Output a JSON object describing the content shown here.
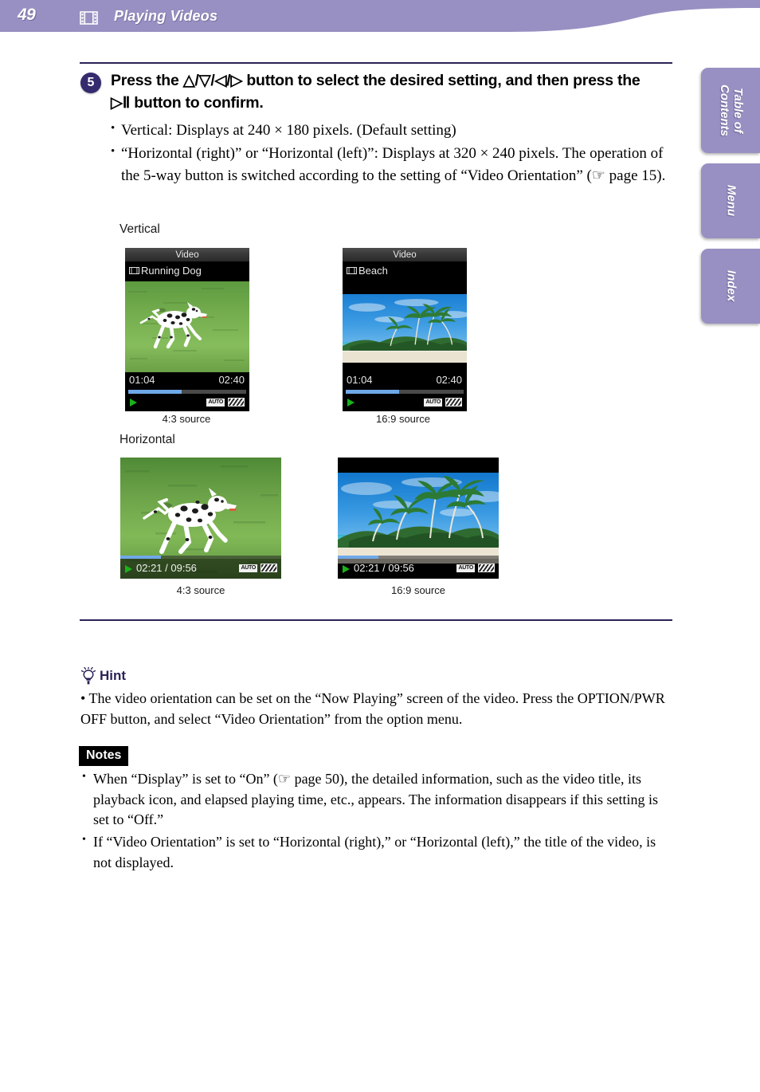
{
  "header": {
    "page_number": "49",
    "title": "Playing Videos",
    "film_icon": "film-strip-icon",
    "bg_color": "#9890c2"
  },
  "side_tabs": [
    {
      "label": "Table of\nContents",
      "name": "table-of-contents"
    },
    {
      "label": "Menu",
      "name": "menu"
    },
    {
      "label": "Index",
      "name": "index"
    }
  ],
  "step": {
    "number": "5",
    "heading": "Press the △/▽/◁/▷ button to select the desired setting, and then press the ▷Ⅱ button to confirm.",
    "bullets": [
      "Vertical: Displays at 240 × 180 pixels. (Default setting)",
      "“Horizontal (right)” or “Horizontal (left)”: Displays at 320 × 240 pixels. The operation of the 5-way button is switched according to the setting of “Video Orientation” (☞ page 15)."
    ]
  },
  "figures": {
    "label_vertical": "Vertical",
    "label_horizontal": "Horizontal",
    "captions": {
      "v43": "4:3 source",
      "v169": "16:9 source",
      "h43": "4:3 source",
      "h169": "16:9 source"
    },
    "vertical_43": {
      "screen_title": "Video",
      "video_title": "Running Dog",
      "time_current": "01:04",
      "time_total": "02:40",
      "progress_percent": 45,
      "badge_auto": "AUTO",
      "play_icon": "play-triangle-icon",
      "battery_icon": "battery-icon"
    },
    "vertical_169": {
      "screen_title": "Video",
      "video_title": "Beach",
      "time_current": "01:04",
      "time_total": "02:40",
      "progress_percent": 45,
      "badge_auto": "AUTO",
      "play_icon": "play-triangle-icon",
      "battery_icon": "battery-icon"
    },
    "horizontal_43": {
      "time": "02:21 / 09:56",
      "progress_percent": 25,
      "badge_auto": "AUTO",
      "play_icon": "play-triangle-icon",
      "battery_icon": "battery-icon"
    },
    "horizontal_169": {
      "time": "02:21 / 09:56",
      "progress_percent": 25,
      "badge_auto": "AUTO",
      "play_icon": "play-triangle-icon",
      "battery_icon": "battery-icon"
    }
  },
  "hint": {
    "label": "Hint",
    "icon": "lightbulb-icon",
    "text": "• The video orientation can be set on the “Now Playing” screen of the video. Press the OPTION/PWR OFF button, and select “Video Orientation” from the option menu."
  },
  "notes": {
    "label": "Notes",
    "items": [
      "When “Display” is set to “On” (☞ page 50), the detailed information, such as the video title, its playback icon, and elapsed playing time, etc., appears. The information disappears if this setting is set to “Off.”",
      "If “Video Orientation” is set to “Horizontal (right),” or “Horizontal (left),” the title of the video, is not displayed."
    ]
  }
}
